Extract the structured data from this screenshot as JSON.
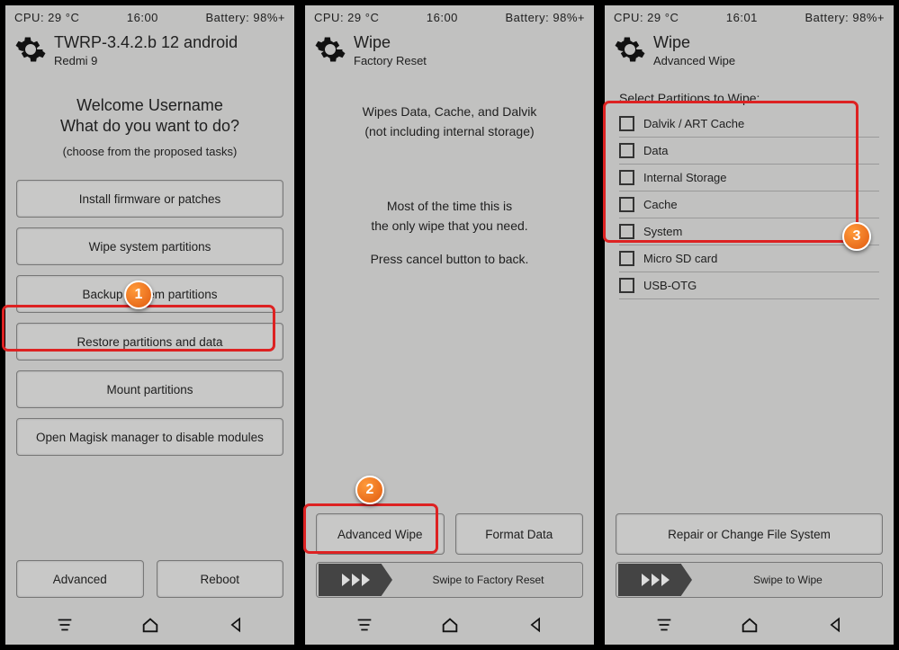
{
  "panels": [
    {
      "status": {
        "cpu": "CPU: 29 °C",
        "time": "16:00",
        "battery": "Battery: 98%+"
      },
      "header": {
        "title": "TWRP-3.4.2.b 12 android",
        "sub": "Redmi 9"
      },
      "welcome": {
        "line1": "Welcome Username",
        "line2": "What do you want to do?",
        "hint": "(choose from the proposed tasks)"
      },
      "main_buttons": [
        "Install firmware or patches",
        "Wipe system partitions",
        "Backup system partitions",
        "Restore partitions and data",
        "Mount partitions",
        "Open Magisk manager to disable modules"
      ],
      "bottom": {
        "left": "Advanced",
        "right": "Reboot"
      }
    },
    {
      "status": {
        "cpu": "CPU: 29 °C",
        "time": "16:00",
        "battery": "Battery: 98%+"
      },
      "header": {
        "title": "Wipe",
        "sub": "Factory Reset"
      },
      "info1a": "Wipes Data, Cache, and Dalvik",
      "info1b": "(not including internal storage)",
      "info2a": "Most of the time this is",
      "info2b": "the only wipe that you need.",
      "info3": "Press cancel button to back.",
      "btns": {
        "left": "Advanced Wipe",
        "right": "Format Data"
      },
      "swipe": "Swipe to Factory Reset"
    },
    {
      "status": {
        "cpu": "CPU: 29 °C",
        "time": "16:01",
        "battery": "Battery: 98%+"
      },
      "header": {
        "title": "Wipe",
        "sub": "Advanced Wipe"
      },
      "select_title": "Select Partitions to Wipe:",
      "partitions": [
        "Dalvik / ART Cache",
        "Data",
        "Internal Storage",
        "Cache",
        "System",
        "Micro SD card",
        "USB-OTG"
      ],
      "repair": "Repair or Change File System",
      "swipe": "Swipe to Wipe"
    }
  ],
  "badges": {
    "1": "1",
    "2": "2",
    "3": "3"
  }
}
